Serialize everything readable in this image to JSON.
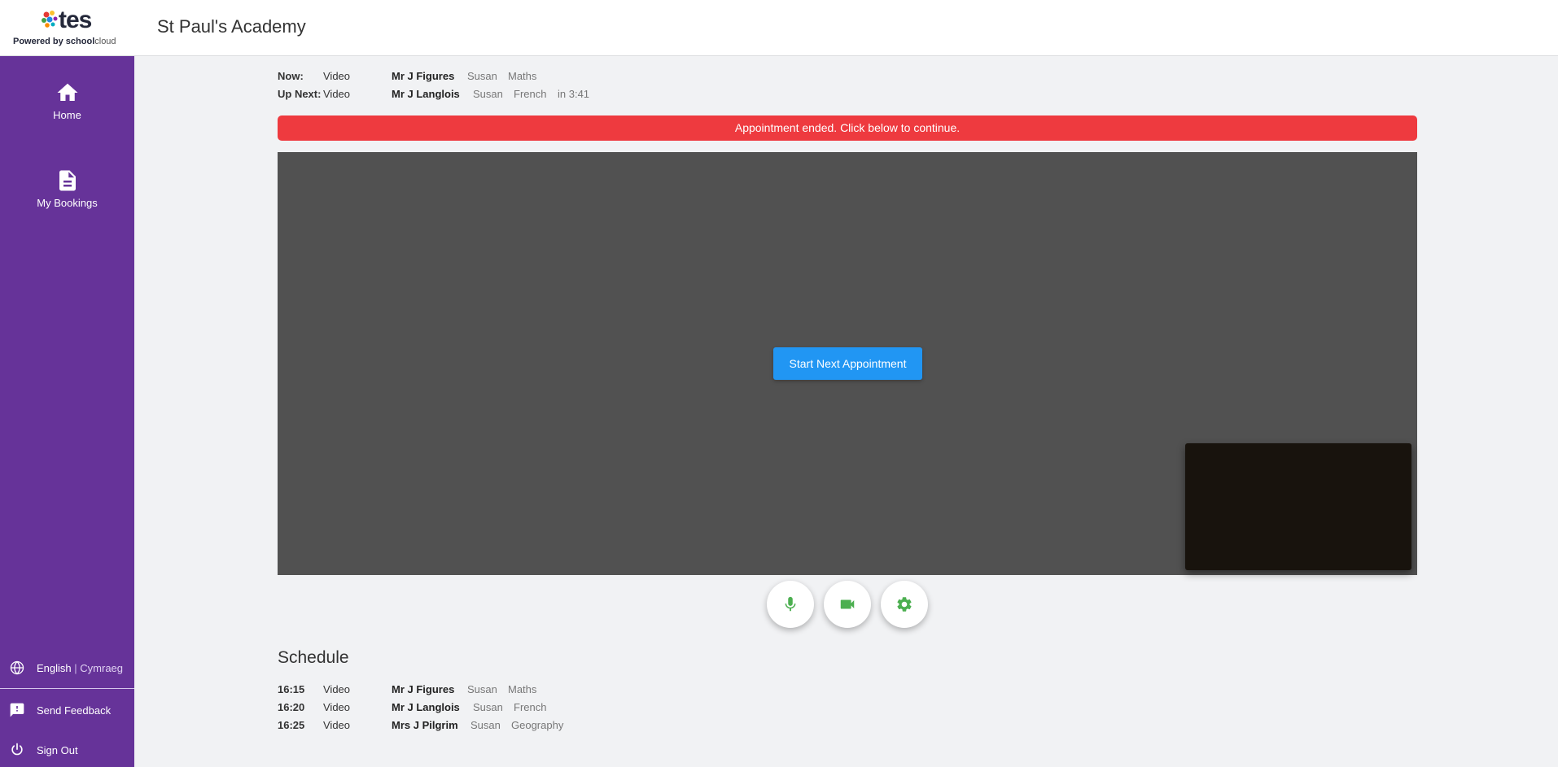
{
  "header": {
    "brand": "tes",
    "powered_prefix": "Powered by ",
    "powered_school": "school",
    "powered_cloud": "cloud",
    "school_name": "St Paul's Academy"
  },
  "sidebar": {
    "background": "#663399",
    "items": [
      {
        "label": "Home",
        "icon": "home-icon"
      },
      {
        "label": "My Bookings",
        "icon": "document-icon"
      }
    ],
    "language": {
      "current": "English",
      "separator": "|",
      "alternate": "Cymraeg",
      "icon": "globe-icon"
    },
    "feedback": {
      "label": "Send Feedback",
      "icon": "feedback-icon"
    },
    "signout": {
      "label": "Sign Out",
      "icon": "power-icon"
    }
  },
  "now": {
    "label": "Now:",
    "type": "Video",
    "teacher": "Mr J Figures",
    "student": "Susan",
    "subject": "Maths"
  },
  "up_next": {
    "label": "Up Next:",
    "type": "Video",
    "teacher": "Mr J Langlois",
    "student": "Susan",
    "subject": "French",
    "countdown": "in 3:41"
  },
  "alert": {
    "text": "Appointment ended. Click below to continue.",
    "color": "#ee3a3f"
  },
  "video": {
    "start_button": "Start Next Appointment",
    "button_color": "#2196f3",
    "controls": [
      {
        "icon": "microphone-icon"
      },
      {
        "icon": "video-camera-icon"
      },
      {
        "icon": "gear-icon"
      }
    ],
    "control_color": "#4caf50"
  },
  "schedule": {
    "title": "Schedule",
    "rows": [
      {
        "time": "16:15",
        "type": "Video",
        "teacher": "Mr J Figures",
        "student": "Susan",
        "subject": "Maths"
      },
      {
        "time": "16:20",
        "type": "Video",
        "teacher": "Mr J Langlois",
        "student": "Susan",
        "subject": "French"
      },
      {
        "time": "16:25",
        "type": "Video",
        "teacher": "Mrs J Pilgrim",
        "student": "Susan",
        "subject": "Geography"
      }
    ]
  }
}
